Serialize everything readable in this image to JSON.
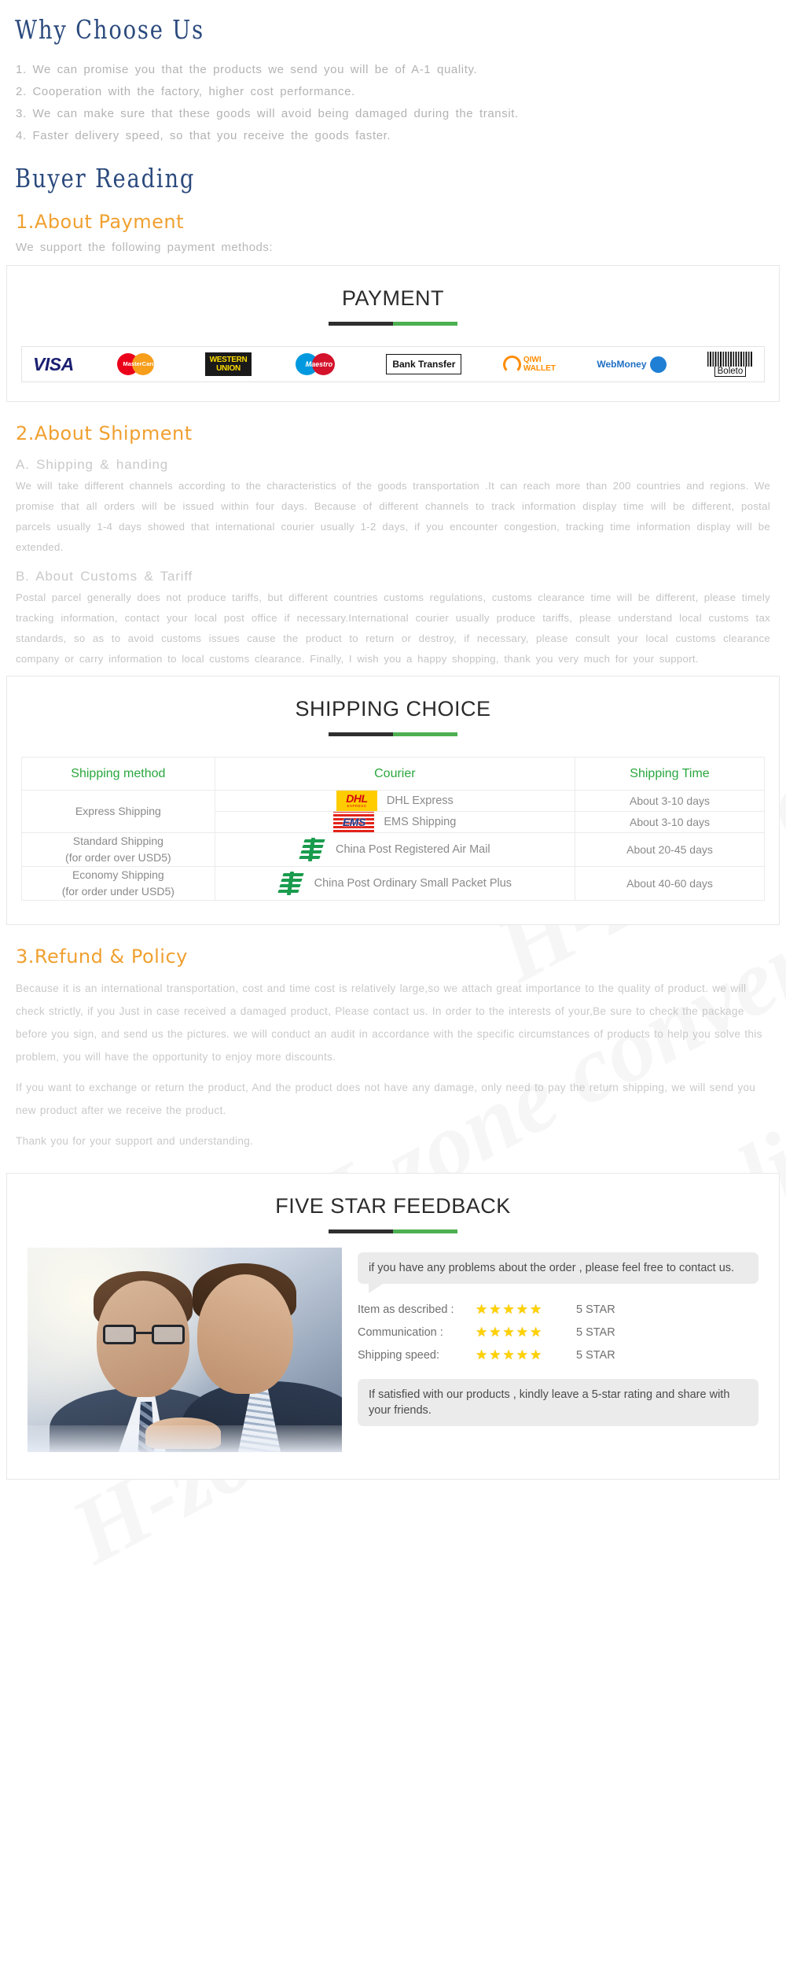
{
  "watermark_text": "H-zone convenient life store",
  "why_choose": {
    "heading": "Why Choose Us",
    "items": [
      "1. We can promise you that the products we send you will be of A-1 quality.",
      "2. Cooperation with the factory, higher cost performance.",
      "3. We can make sure that these goods will avoid being damaged during the transit.",
      "4. Faster delivery speed, so that you receive the goods faster."
    ]
  },
  "buyer_reading": {
    "heading": "Buyer Reading"
  },
  "payment": {
    "section_heading": "1.About Payment",
    "note": "We support the following payment methods:",
    "panel_title": "PAYMENT",
    "methods": [
      {
        "name": "visa-logo",
        "label": "VISA"
      },
      {
        "name": "mastercard-logo",
        "label": "MasterCard"
      },
      {
        "name": "western-union-logo",
        "line1": "WESTERN",
        "line2": "UNION"
      },
      {
        "name": "maestro-logo",
        "label": "Maestro"
      },
      {
        "name": "bank-transfer-logo",
        "label": "Bank Transfer"
      },
      {
        "name": "qiwi-wallet-logo",
        "line1": "QIWI",
        "line2": "WALLET"
      },
      {
        "name": "webmoney-logo",
        "label": "WebMoney"
      },
      {
        "name": "boleto-logo",
        "label": "Boleto"
      }
    ]
  },
  "shipment": {
    "section_heading": "2.About Shipment",
    "sub_a_heading": "A. Shipping & handing",
    "sub_a_text": "We will take different channels according to the characteristics of the goods transportation .It can reach more than 200 countries and regions. We promise that all orders will be issued within four days. Because of different channels to track information display time will be different, postal parcels usually 1-4 days showed that international courier usually 1-2 days, if you encounter congestion, tracking time information display will be extended.",
    "sub_b_heading": "B. About Customs & Tariff",
    "sub_b_text": "Postal parcel generally does not produce tariffs, but different countries customs regulations, customs clearance time will be different, please timely tracking information, contact your local post office if necessary.International courier usually produce tariffs, please understand local customs tax standards, so as to avoid customs issues cause the product to return or destroy, if necessary, please consult your local customs clearance company or carry information to local customs clearance. Finally, I wish you a happy shopping, thank you very much for your support.",
    "table_title": "SHIPPING CHOICE",
    "table_headers": [
      "Shipping method",
      "Courier",
      "Shipping Time"
    ],
    "rows": [
      {
        "method": "Express Shipping",
        "method_sub": "",
        "rowspan": 2,
        "couriers": [
          {
            "logo": "dhl-logo",
            "name": "DHL Express",
            "time": "About 3-10 days"
          },
          {
            "logo": "ems-logo",
            "name": "EMS Shipping",
            "time": "About 3-10 days"
          }
        ]
      },
      {
        "method": "Standard Shipping",
        "method_sub": "(for order over USD5)",
        "rowspan": 1,
        "couriers": [
          {
            "logo": "china-post-logo",
            "name": "China Post Registered Air Mail",
            "time": "About 20-45 days"
          }
        ]
      },
      {
        "method": "Economy Shipping",
        "method_sub": "(for order under USD5)",
        "rowspan": 1,
        "couriers": [
          {
            "logo": "china-post-logo",
            "name": "China Post Ordinary Small Packet Plus",
            "time": "About 40-60 days"
          }
        ]
      }
    ]
  },
  "refund": {
    "section_heading": "3.Refund & Policy",
    "paragraphs": [
      "Because it is an international transportation, cost and time cost is relatively large,so we attach great importance to the quality of product. we will check strictly, if you Just in case received a damaged product, Please contact us. In order to the interests of your,Be sure to check the package before you sign, and send us the pictures. we will conduct an audit in accordance with the specific circumstances of products to help you solve this problem, you will have the opportunity to enjoy more discounts.",
      "If you want to exchange or return the product, And the product does not have any damage, only need to pay the return shipping, we will send you new product after we receive the product.",
      "Thank you for your support and understanding."
    ]
  },
  "feedback": {
    "panel_title": "FIVE STAR FEEDBACK",
    "photo_alt": "two-businessmen-photo",
    "bubble_top": "if you have any problems about the order , please feel free to contact us.",
    "ratings": [
      {
        "label": "Item as described :",
        "stars": "★★★★★",
        "value": "5 STAR"
      },
      {
        "label": "Communication :",
        "stars": "★★★★★",
        "value": "5 STAR"
      },
      {
        "label": "Shipping speed:",
        "stars": "★★★★★",
        "value": "5 STAR"
      }
    ],
    "bubble_bottom": "If satisfied with our products ,  kindly leave a 5-star rating and share with your friends."
  },
  "colors": {
    "blue_heading": "#2b4a7d",
    "orange_heading": "#f0a030",
    "green_accent": "#4caf50",
    "table_header_green": "#2aa73f",
    "star_yellow": "#ffd200",
    "body_grey": "#c4c4c4"
  }
}
